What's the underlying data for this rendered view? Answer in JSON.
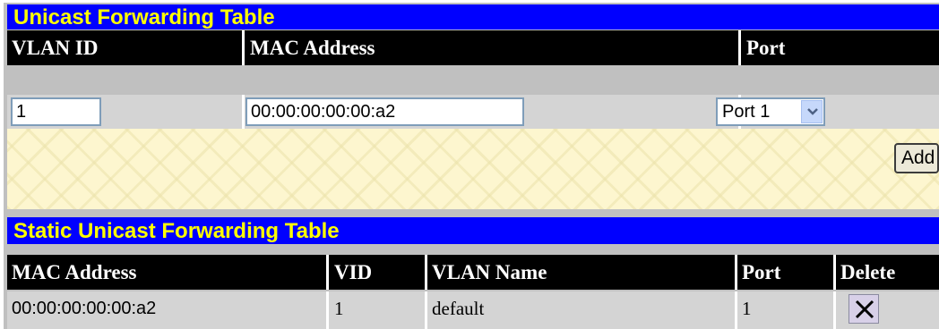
{
  "forwarding": {
    "title": "Unicast Forwarding Table",
    "col_vlan_id": "VLAN ID",
    "col_mac": "MAC Address",
    "col_port": "Port",
    "vlan_id_value": "1",
    "mac_value": "00:00:00:00:00:a2",
    "port_selected": "Port 1",
    "add_label": "Add"
  },
  "static_table": {
    "title": "Static Unicast Forwarding Table",
    "columns": [
      "MAC Address",
      "VID",
      "VLAN Name",
      "Port",
      "Delete"
    ],
    "rows": [
      {
        "mac": "00:00:00:00:00:a2",
        "vid": "1",
        "vlan_name": "default",
        "port": "1",
        "delete_icon": "x-icon"
      }
    ]
  },
  "colors": {
    "title_bar": "#0000ff",
    "title_text": "#ffff00",
    "header_bg": "#000000",
    "row_bg": "#d4d4d4"
  }
}
